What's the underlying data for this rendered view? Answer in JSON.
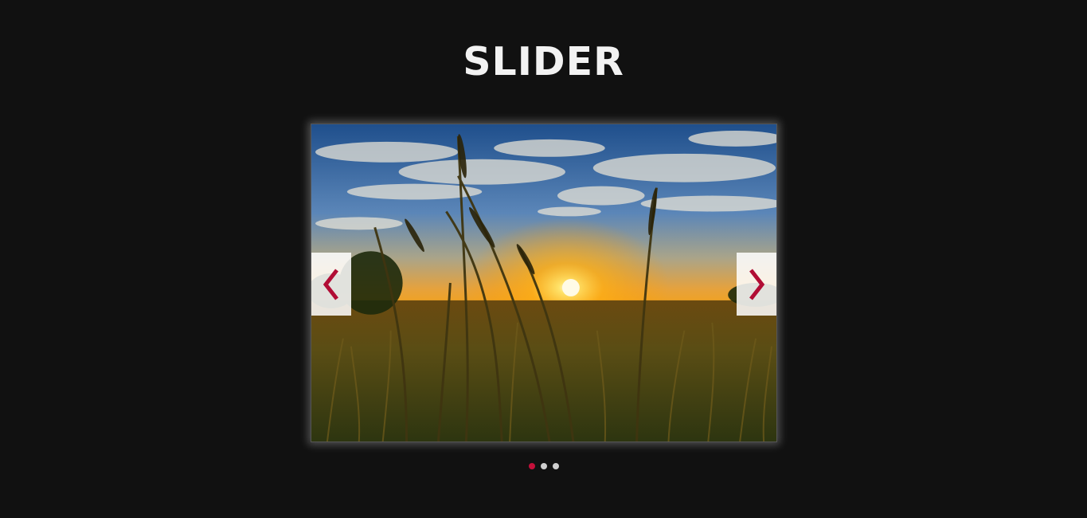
{
  "page": {
    "title": "SLIDER"
  },
  "slider": {
    "current_slide": 1,
    "slide_count": 3,
    "slide_image": "sunset-wheat-field",
    "prev_icon": "chevron-left-icon",
    "next_icon": "chevron-right-icon",
    "dots": [
      {
        "active": true
      },
      {
        "active": false
      },
      {
        "active": false
      }
    ]
  },
  "colors": {
    "background": "#111111",
    "title": "#f2f2f2",
    "accent": "#c4103a",
    "arrow_background": "#ffffff",
    "dot_inactive": "#cfcfcf"
  }
}
